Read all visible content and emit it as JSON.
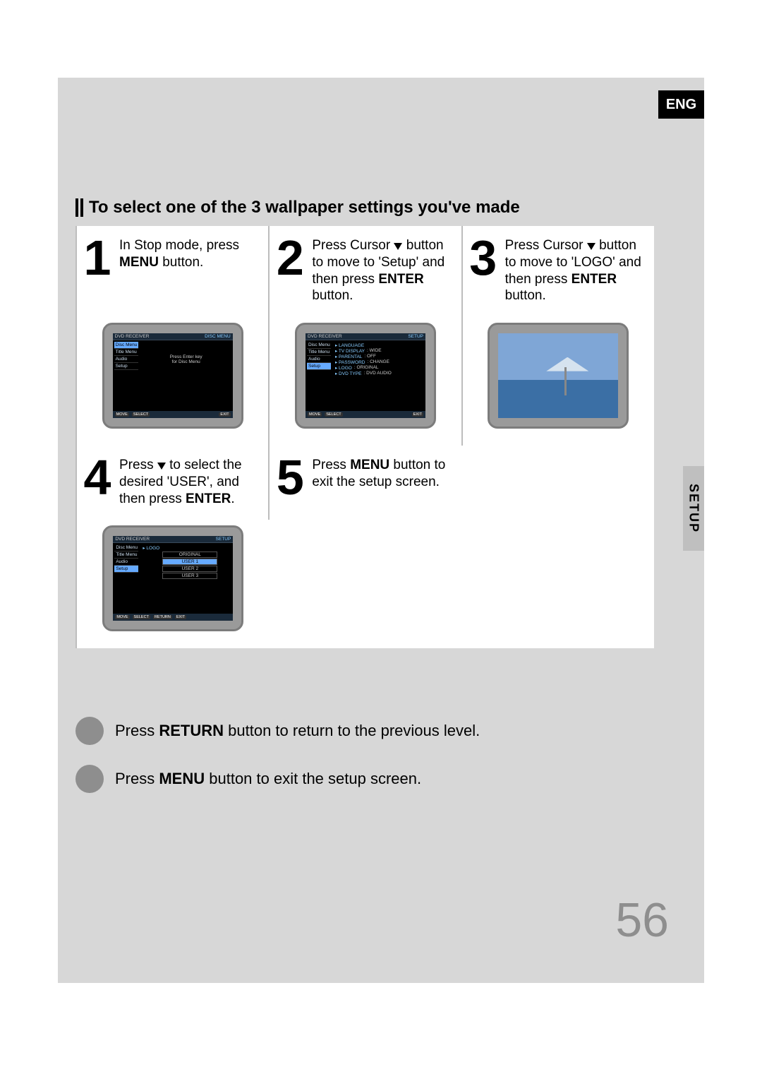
{
  "lang_label": "ENG",
  "side_tab": "SETUP",
  "page_number": "56",
  "section_title": "To select one of the 3 wallpaper settings you've made",
  "steps": [
    {
      "num": "1",
      "html": "In Stop mode, press <b>MENU</b> button."
    },
    {
      "num": "2",
      "html": "Press Cursor <span class='tri-down'></span> button to move to 'Setup' and then press <b>ENTER</b> button."
    },
    {
      "num": "3",
      "html": "Press Cursor <span class='tri-down'></span> button to move to 'LOGO' and then press <b>ENTER</b> button."
    },
    {
      "num": "4",
      "html": "Press <span class='tri-down'></span> to select the desired 'USER', and then press <b>ENTER</b>."
    },
    {
      "num": "5",
      "html": "Press <b>MENU</b> button to exit the setup screen."
    }
  ],
  "tv1": {
    "top_left": "DVD RECEIVER",
    "top_right": "DISC MENU",
    "left": [
      "Disc Menu",
      "Title Menu",
      "Audio",
      "Setup"
    ],
    "center1": "Press Enter key",
    "center2": "for Disc Menu",
    "bottom": [
      "MOVE",
      "SELECT",
      "EXIT"
    ]
  },
  "tv2": {
    "top_left": "DVD RECEIVER",
    "top_right": "SETUP",
    "left": [
      "Disc Menu",
      "Title Menu",
      "Audio",
      "Setup"
    ],
    "rows": [
      [
        "▸ LANGUAGE",
        ""
      ],
      [
        "▸ TV DISPLAY",
        ": WIDE"
      ],
      [
        "▸ PARENTAL",
        ": OFF"
      ],
      [
        "▸ PASSWORD",
        ": CHANGE"
      ],
      [
        "▸ LOGO",
        ": ORIGINAL"
      ],
      [
        "▸ DVD TYPE",
        ": DVD AUDIO"
      ]
    ],
    "bottom": [
      "MOVE",
      "SELECT",
      "EXIT"
    ]
  },
  "tv4": {
    "top_left": "DVD RECEIVER",
    "top_right": "SETUP",
    "left": [
      "Disc Menu",
      "Title Menu",
      "Audio",
      "Setup"
    ],
    "label": "▸ LOGO",
    "options": [
      "ORIGINAL",
      "USER 1",
      "USER 2",
      "USER 3"
    ],
    "selected": 1,
    "bottom": [
      "MOVE",
      "SELECT",
      "RETURN",
      "EXIT"
    ]
  },
  "tips": [
    "Press <b>RETURN</b> button to return to the previous level.",
    "Press <b>MENU</b> button to exit the setup screen."
  ]
}
